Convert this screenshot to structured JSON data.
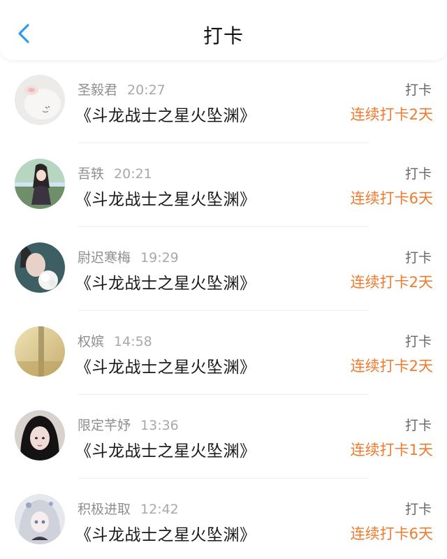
{
  "header": {
    "title": "打卡",
    "back_icon": "chevron-left-icon",
    "accent_color": "#2e9cf0"
  },
  "streak_color": "#f07a2d",
  "items": [
    {
      "user": "圣毅君",
      "time": "20:27",
      "book": "《斗龙战士之星火坠渊》",
      "action": "打卡",
      "streak": "连续打卡2天"
    },
    {
      "user": "吾轶",
      "time": "20:21",
      "book": "《斗龙战士之星火坠渊》",
      "action": "打卡",
      "streak": "连续打卡6天"
    },
    {
      "user": "尉迟寒梅",
      "time": "19:29",
      "book": "《斗龙战士之星火坠渊》",
      "action": "打卡",
      "streak": "连续打卡2天"
    },
    {
      "user": "权嫔",
      "time": "14:58",
      "book": "《斗龙战士之星火坠渊》",
      "action": "打卡",
      "streak": "连续打卡2天"
    },
    {
      "user": "限定芊妤",
      "time": "13:36",
      "book": "《斗龙战士之星火坠渊》",
      "action": "打卡",
      "streak": "连续打卡1天"
    },
    {
      "user": "积极进取",
      "time": "12:42",
      "book": "《斗龙战士之星火坠渊》",
      "action": "打卡",
      "streak": "连续打卡6天"
    }
  ]
}
